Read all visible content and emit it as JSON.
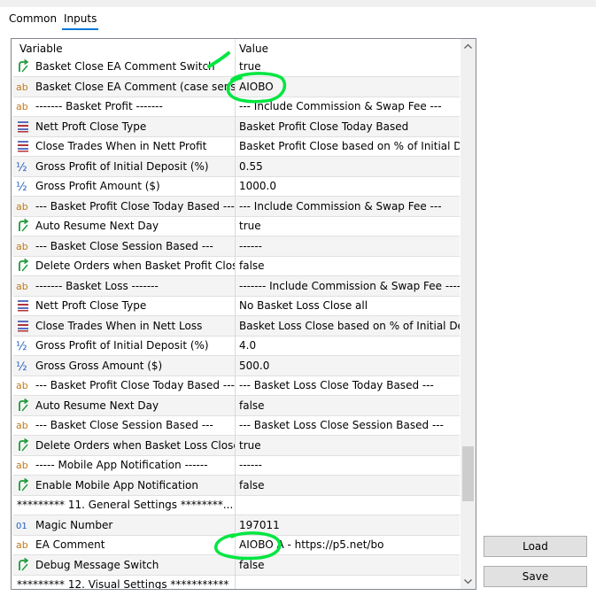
{
  "tabs": [
    {
      "label": "Common",
      "active": false
    },
    {
      "label": "Inputs",
      "active": true
    }
  ],
  "grid": {
    "columns": {
      "variable": "Variable",
      "value": "Value"
    },
    "rows": [
      {
        "icon": "bool-arrow-icon",
        "variable": "Basket Close EA Comment Switch",
        "value": "true"
      },
      {
        "icon": "ab-string-icon",
        "variable": "Basket Close EA Comment (case sensiti...",
        "value": "AIOBO"
      },
      {
        "icon": "ab-string-icon",
        "variable": "------- Basket Profit  -------",
        "value": "--- Include Commission & Swap Fee ---"
      },
      {
        "icon": "enum-list-icon",
        "variable": "Nett Proft Close Type",
        "value": "Basket Profit Close Today Based"
      },
      {
        "icon": "enum-list-icon",
        "variable": "Close Trades When in Nett Profit",
        "value": "Basket Profit Close based on % of Initial D..."
      },
      {
        "icon": "half-fraction-icon",
        "variable": "Gross Profit of Initial Deposit (%)",
        "value": "0.55"
      },
      {
        "icon": "half-fraction-icon",
        "variable": "Gross Profit Amount ($)",
        "value": "1000.0"
      },
      {
        "icon": "ab-string-icon",
        "variable": "--- Basket Profit Close Today Based ---",
        "value": "--- Include Commission & Swap Fee ---"
      },
      {
        "icon": "bool-arrow-icon",
        "variable": "Auto Resume Next Day",
        "value": "true"
      },
      {
        "icon": "ab-string-icon",
        "variable": "--- Basket Close Session Based ---",
        "value": "------"
      },
      {
        "icon": "bool-arrow-icon",
        "variable": "Delete Orders when Basket Profit Close ...",
        "value": "false"
      },
      {
        "icon": "ab-string-icon",
        "variable": "------- Basket Loss -------",
        "value": "------- Include Commission & Swap Fee ----..."
      },
      {
        "icon": "enum-list-icon",
        "variable": "Nett Proft Close Type",
        "value": "No Basket Loss Close all"
      },
      {
        "icon": "enum-list-icon",
        "variable": "Close Trades When in Nett Loss",
        "value": "Basket Loss Close based on %  of Initial De..."
      },
      {
        "icon": "half-fraction-icon",
        "variable": "Gross Profit of Initial Deposit (%)",
        "value": "4.0"
      },
      {
        "icon": "half-fraction-icon",
        "variable": "Gross Gross Amount ($)",
        "value": "500.0"
      },
      {
        "icon": "ab-string-icon",
        "variable": "--- Basket Profit Close Today Based ---",
        "value": "--- Basket Loss  Close Today Based ---"
      },
      {
        "icon": "bool-arrow-icon",
        "variable": "Auto Resume Next Day",
        "value": "false"
      },
      {
        "icon": "ab-string-icon",
        "variable": "--- Basket Close Session Based ---",
        "value": "--- Basket Loss Close Session Based ---"
      },
      {
        "icon": "bool-arrow-icon",
        "variable": "Delete Orders when Basket Loss Close i...",
        "value": "true"
      },
      {
        "icon": "ab-string-icon",
        "variable": "----- Mobile App Notification ------",
        "value": "------"
      },
      {
        "icon": "bool-arrow-icon",
        "variable": "Enable Mobile App Notification",
        "value": "false"
      },
      {
        "icon": "none",
        "variable": "********* 11. General Settings ********...",
        "value": ""
      },
      {
        "icon": "int-01-icon",
        "variable": "Magic Number",
        "value": "197011"
      },
      {
        "icon": "ab-string-icon",
        "variable": "EA Comment",
        "value": "AIOBO A - https://p5.net/bo"
      },
      {
        "icon": "bool-arrow-icon",
        "variable": "Debug Message Switch",
        "value": "false"
      },
      {
        "icon": "none",
        "variable": "********* 12. Visual Settings ***********",
        "value": ""
      }
    ]
  },
  "buttons": {
    "load": "Load",
    "save": "Save"
  },
  "colors": {
    "accent": "#0078d7",
    "annotation": "#00e640",
    "bool_icon": "#1f9a3a",
    "ab_icon": "#c07a1a",
    "enum_icon": "#b0353a",
    "num_icon": "#1f5fbf"
  }
}
